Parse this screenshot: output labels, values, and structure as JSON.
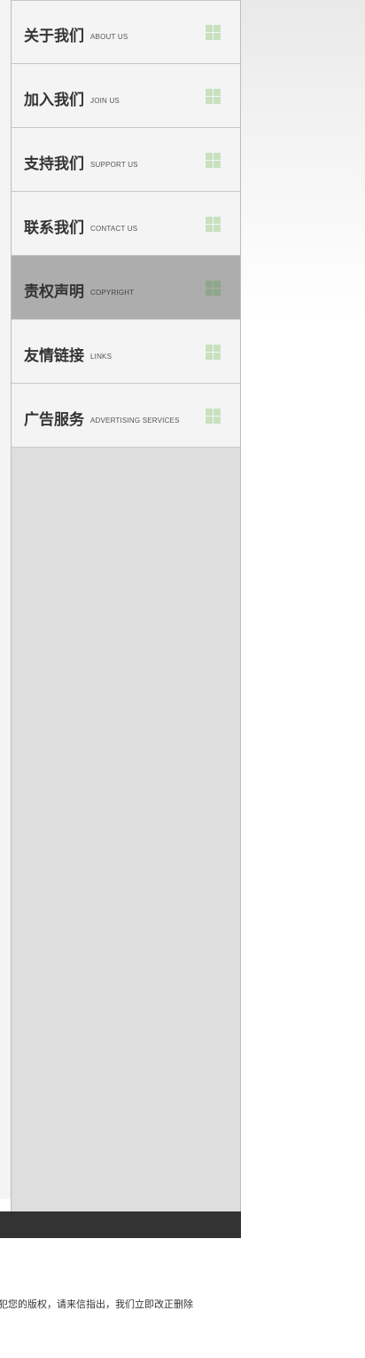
{
  "sidebar": {
    "items": [
      {
        "zh": "关于我们",
        "en": "ABOUT US"
      },
      {
        "zh": "加入我们",
        "en": "JOIN US"
      },
      {
        "zh": "支持我们",
        "en": "SUPPORT US"
      },
      {
        "zh": "联系我们",
        "en": "CONTACT US"
      },
      {
        "zh": "责权声明",
        "en": "COPYRIGHT"
      },
      {
        "zh": "友情链接",
        "en": "LINKS"
      },
      {
        "zh": "广告服务",
        "en": "ADVERTISING SERVICES"
      }
    ],
    "active_index": 4,
    "icon": "grid-icon",
    "icon_color": "#c8e0bd",
    "active_icon_color": "#8da88a"
  },
  "footer": {
    "notice": "犯您的版权，请来信指出，我们立即改正删除"
  }
}
